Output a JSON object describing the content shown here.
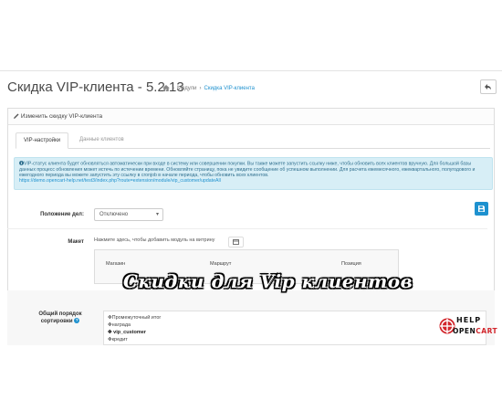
{
  "header": {
    "title": "Скидка VIP-клиента - 5.2.13",
    "breadcrumb": [
      "Модули",
      "Скидка VIP-клиента"
    ],
    "breadcrumb_sep": "›"
  },
  "panel": {
    "title": "Изменить скидку VIP-клиента"
  },
  "tabs": [
    {
      "label": "VIP-настройки",
      "active": true
    },
    {
      "label": "Данные клиентов",
      "active": false
    }
  ],
  "alert": {
    "text": "VIP-статус клиента будет обновляться автоматически при входе в систему или совершении покупки. Вы также можете запустить ссылку ниже, чтобы обновить всех клиентов вручную. Для большой базы данных процесс обновления может истечь по истечении времени. Обновляйте страницу, пока не увидите сообщение об успешном выполнении. Для расчета ежемесячного, ежеквартального, полугодового и ежегодного периода вы можете запустить эту ссылку в cronjob в начале периода, чтобы обновить всех клиентов.",
    "link": "https://demo.opencart-help.net/test3/index.php?route=extension/module/vip_customer/updateAll"
  },
  "form": {
    "position_label": "Положение дел:",
    "status_value": "Отключено",
    "layout_label": "Макет",
    "layout_hint": "Нажмите здесь, чтобы добавить модуль на витрину",
    "columns": [
      "Магазин",
      "Маршрут",
      "Позиция"
    ],
    "sort_label": "Общий порядок сортировки",
    "sort_items": [
      "Промежуточный итог",
      "награда",
      "vip_customer",
      "кредит"
    ]
  },
  "overlay": {
    "caption": "Скидки для Vip клиентов",
    "logo_top": "HELP",
    "logo_bottom_a": "OPEN",
    "logo_bottom_b": "CART"
  },
  "colors": {
    "accent": "#1e91cf",
    "alert_bg": "#d7eef6",
    "alert_text": "#31708f"
  },
  "icons": [
    "home-icon",
    "back-icon",
    "pencil-icon",
    "info-icon",
    "save-icon",
    "caret-down-icon",
    "layout-icon",
    "help-icon",
    "move-icon"
  ]
}
